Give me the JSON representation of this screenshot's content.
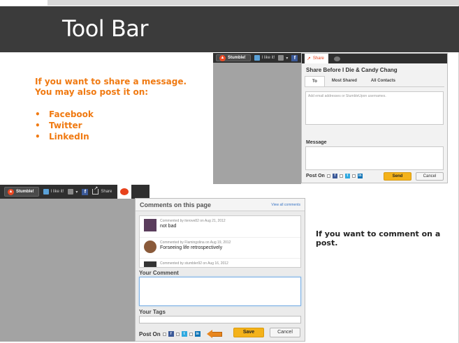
{
  "slide": {
    "title": "Tool Bar",
    "intro_line1": "If you want to share a message.",
    "intro_line2": "You may also post it on:",
    "bullets": [
      "Facebook",
      "Twitter",
      "LinkedIn"
    ],
    "comment_note": "If you want to comment on a post."
  },
  "toolbar_top": {
    "stumble_label": "Stumble!",
    "like_label": "I like it!",
    "dislike_arrow": "▾"
  },
  "share_panel": {
    "tab_share_label": "Share",
    "title": "Share Before I Die & Candy Chang",
    "tabs": [
      "To",
      "Most Shared",
      "All Contacts"
    ],
    "to_placeholder": "Add email addresses or StumbleUpon usernames.",
    "message_label": "Message",
    "post_on_label": "Post On",
    "send_label": "Send",
    "cancel_label": "Cancel"
  },
  "toolbar_bottom": {
    "stumble_label": "Stumble!",
    "like_label": "I like it!",
    "dislike_arrow": "▾",
    "share_label": "Share"
  },
  "comments_panel": {
    "title": "Comments on this page",
    "view_all_label": "View all comments",
    "comments": [
      {
        "meta": "Commented by iterove82 on Aug 21, 2012",
        "text": "not bad"
      },
      {
        "meta": "Commented by Flamingolina on Aug 19, 2012",
        "text": "Forseeing life retrospectively"
      },
      {
        "meta": "Commented by stumbler92 on Aug 16, 2012",
        "text": ""
      }
    ],
    "your_comment_label": "Your Comment",
    "your_tags_label": "Your Tags",
    "post_on_label": "Post On",
    "save_label": "Save",
    "cancel_label": "Cancel"
  },
  "colors": {
    "title_bar": "#3b3b3b",
    "orange_text": "#f07a12",
    "stumble_red": "#eb4924",
    "facebook": "#3b5998",
    "twitter": "#2fa9e0",
    "linkedin": "#0b72b5",
    "send_button": "#f4b21a",
    "arrow": "#e8861e"
  }
}
